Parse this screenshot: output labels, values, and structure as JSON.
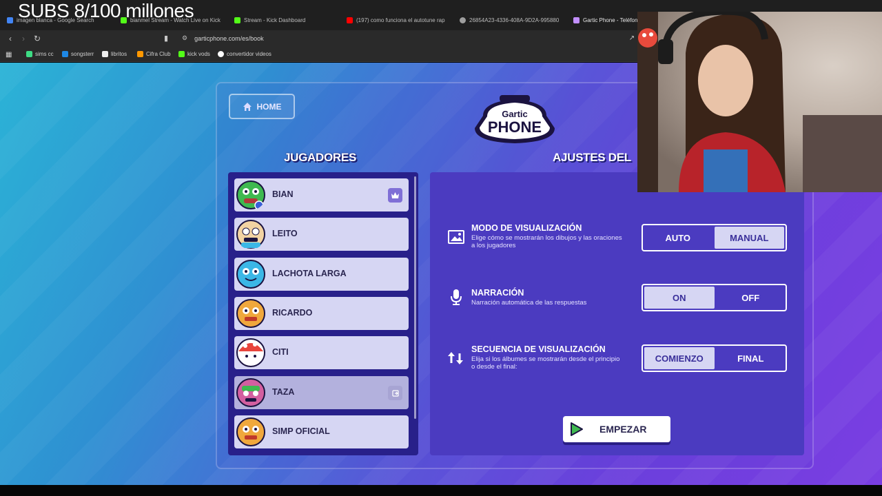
{
  "stream_overlay": {
    "subs_text": "SUBS 8/100 millones"
  },
  "browser": {
    "tabs": [
      {
        "label": "imagen blanca - Google Search",
        "color": "#4285f4"
      },
      {
        "label": "bianmel Stream - Watch Live on Kick",
        "color": "#53fc18"
      },
      {
        "label": "Stream - Kick Dashboard",
        "color": "#53fc18"
      },
      {
        "label": "(197) como funciona el autotune rap",
        "color": "#ff0000"
      },
      {
        "label": "26854A23-4336-408A-9D2A-995880",
        "color": "#9e9e9e"
      },
      {
        "label": "Gartic Phone - Teléfon",
        "color": "#c28fff"
      }
    ],
    "url": "garticphone.com/es/book",
    "bookmarks": [
      {
        "label": "sims cc",
        "color": "#3ddc84"
      },
      {
        "label": "songsterr",
        "color": "#1e88e5"
      },
      {
        "label": "libritos",
        "color": "#eeeeee"
      },
      {
        "label": "Cifra Club",
        "color": "#ff9800"
      },
      {
        "label": "kick vods",
        "color": "#53fc18"
      },
      {
        "label": "convertidor videos",
        "color": "#ffffff"
      }
    ]
  },
  "game": {
    "home_label": "HOME",
    "logo_top": "Gartic",
    "logo_bottom": "PHONE",
    "players_title": "JUGADORES",
    "settings_title": "AJUSTES DEL",
    "players": [
      {
        "name": "BIAN",
        "avatar_color": "#3fb950",
        "badge": "crown-icon"
      },
      {
        "name": "LEITO",
        "avatar_color": "#f2d3a2",
        "badge": ""
      },
      {
        "name": "LACHOTA LARGA",
        "avatar_color": "#3bb7e6",
        "badge": ""
      },
      {
        "name": "RICARDO",
        "avatar_color": "#f0a83c",
        "badge": ""
      },
      {
        "name": "CITI",
        "avatar_color": "#e8453c",
        "badge": ""
      },
      {
        "name": "TAZA",
        "avatar_color": "#d35fa0",
        "badge": "kick-icon"
      },
      {
        "name": "SIMP OFICIAL",
        "avatar_color": "#f0a83c",
        "badge": ""
      }
    ],
    "settings": {
      "view_mode": {
        "title": "MODO DE VISUALIZACIÓN",
        "desc": "Elige cómo se mostrarán los dibujos y las oraciones a los jugadores",
        "options": [
          "AUTO",
          "MANUAL"
        ],
        "selected": "MANUAL"
      },
      "narration": {
        "title": "NARRACIÓN",
        "desc": "Narración automática de las respuestas",
        "options": [
          "ON",
          "OFF"
        ],
        "selected": "ON"
      },
      "sequence": {
        "title": "SECUENCIA DE VISUALIZACIÓN",
        "desc": "Elija si los álbumes se mostrarán desde el principio o desde el final:",
        "options": [
          "COMIENZO",
          "FINAL"
        ],
        "selected": "COMIENZO"
      }
    },
    "start_label": "EMPEZAR"
  }
}
